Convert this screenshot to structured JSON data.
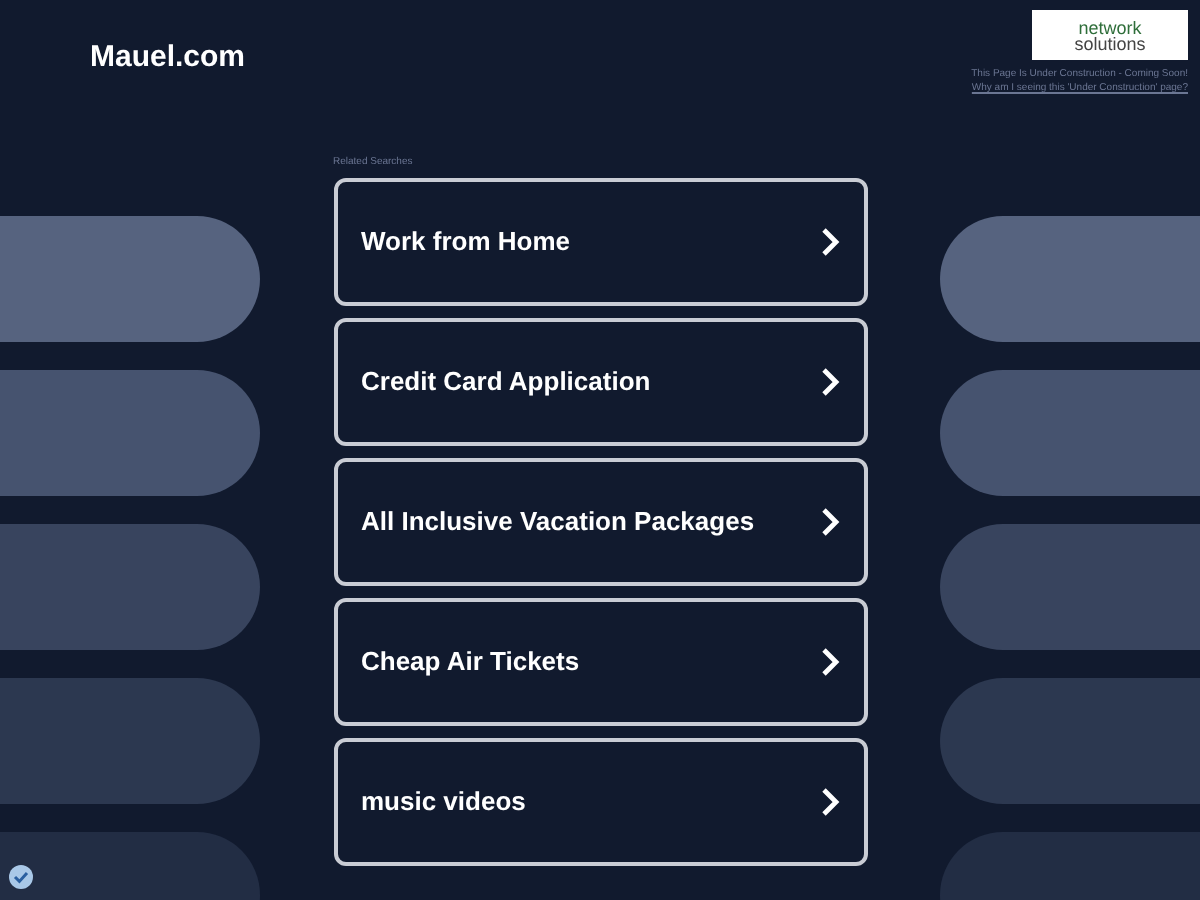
{
  "site_title": "Mauel.com",
  "logo": {
    "line_1": "network",
    "line_2": "solutions"
  },
  "notice": {
    "text": "This Page Is Under Construction - Coming Soon!",
    "link": "Why am I seeing this 'Under Construction' page?"
  },
  "related_searches": {
    "heading": "Related Searches",
    "items": [
      {
        "label": "Work from Home"
      },
      {
        "label": "Credit Card Application"
      },
      {
        "label": "All Inclusive Vacation Packages"
      },
      {
        "label": "Cheap Air Tickets"
      },
      {
        "label": "music videos"
      }
    ]
  }
}
